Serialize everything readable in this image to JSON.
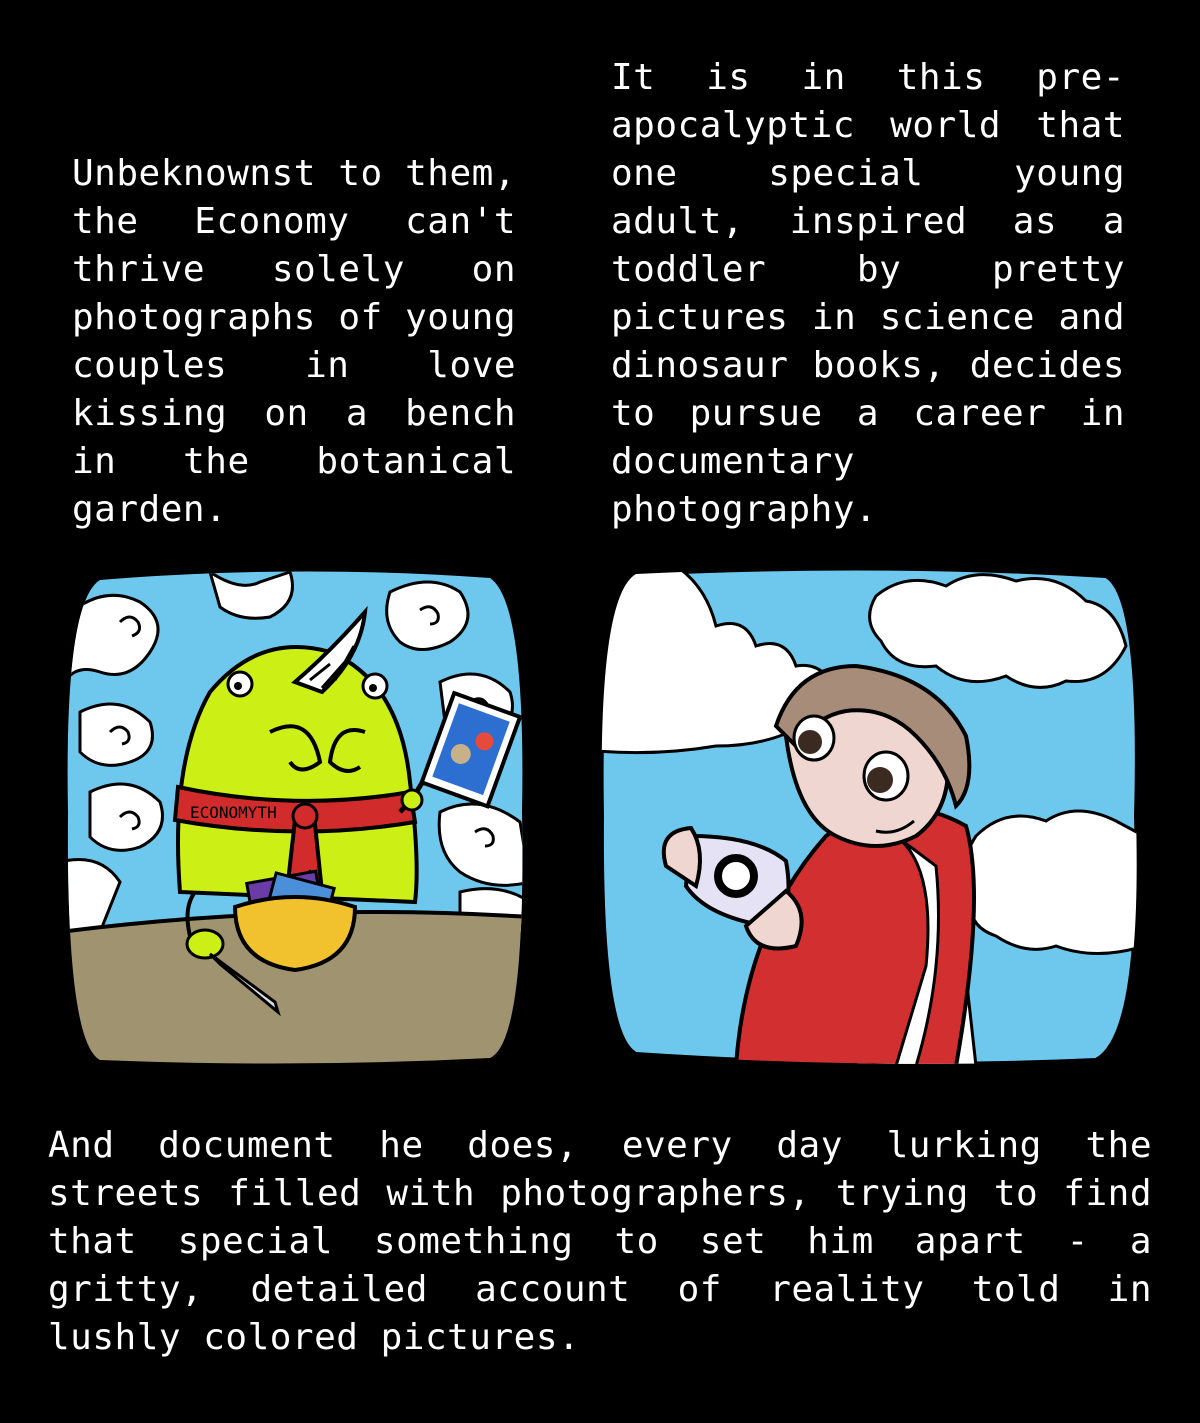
{
  "captions": {
    "left": "Unbeknownst to them, the Economy can't thrive solely on photographs of young couples in love kissing on a bench in the botanical garden.",
    "right": "It is in this pre-apocalyptic world that one special young adult, inspired as a toddler by pretty pictures in science and dinosaur books, decides to pursue a career in documentary photography.",
    "bottom": "And document he does, every day lurking the streets filled with photographers, trying to find that special something to set him apart - a gritty, detailed account of reality told in lushly colored pictures."
  },
  "panel1": {
    "scarf_text": "ECONOMYTH",
    "colors": {
      "sky": "#6ec8ee",
      "creature": "#ccf016",
      "scarf": "#d12b2b",
      "table": "#a09470",
      "bowl": "#f2c12e"
    }
  },
  "panel2": {
    "colors": {
      "sky": "#6ec8ee",
      "hair": "#a88c7a",
      "skin": "#f0d6d0",
      "shirt": "#d23030",
      "camera": "#e6e2f6"
    }
  }
}
